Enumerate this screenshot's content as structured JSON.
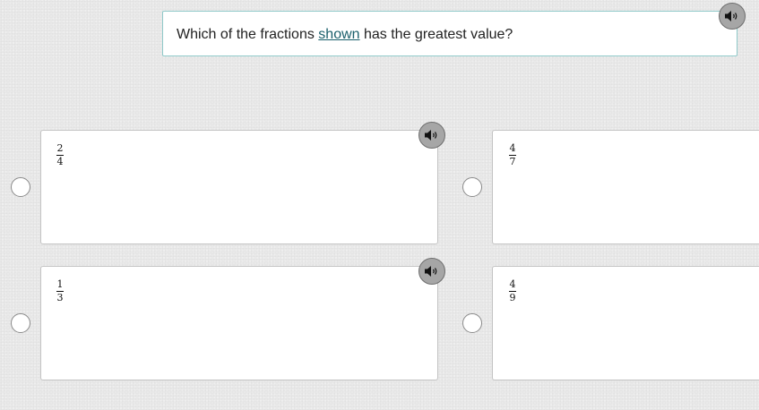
{
  "question": {
    "text_before": "Which of the fractions ",
    "link_text": "shown",
    "text_after": " has the greatest value?",
    "audio_icon": "speaker-icon"
  },
  "options": [
    {
      "numerator": "2",
      "denominator": "4",
      "selected": false,
      "has_audio": true
    },
    {
      "numerator": "4",
      "denominator": "7",
      "selected": false,
      "has_audio": false
    },
    {
      "numerator": "1",
      "denominator": "3",
      "selected": false,
      "has_audio": true
    },
    {
      "numerator": "4",
      "denominator": "9",
      "selected": false,
      "has_audio": false
    }
  ],
  "colors": {
    "link": "#1a5f6b",
    "question_border": "#8fc9c9",
    "audio_button": "#a6a6a6"
  }
}
